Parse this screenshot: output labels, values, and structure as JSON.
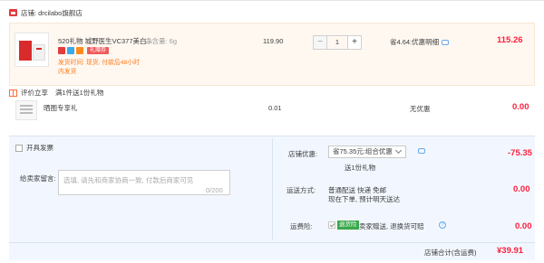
{
  "store": {
    "label": "店铺:",
    "name": "drcilabo旗舰店"
  },
  "item": {
    "title": "520礼物 城野医生VC377美白...",
    "spec": "净含量: 6g",
    "gift_badge": "礼赠券",
    "ship_line1": "发货时间: 现货, 付款后48小时",
    "ship_line2": "内发货",
    "price": "119.90",
    "quantity": "1",
    "discount": "省4.64:优惠明细",
    "subtotal": "115.26"
  },
  "review_gift": {
    "tag": "评价立享",
    "desc": "满1件送1份礼物",
    "gift_name": "晒图专享礼",
    "gift_price": "0.01",
    "gift_discount": "无优惠",
    "gift_subtotal": "0.00"
  },
  "options": {
    "invoice_label": "开具发票",
    "message_label": "给卖家留言:",
    "message_placeholder": "选填, 请先和商家协商一致, 付款后商家可见",
    "message_count": "0/200",
    "shop_discount_label": "店铺优惠:",
    "shop_discount_select": "省75.35元:组合优惠",
    "shop_discount_sub": "送1份礼物",
    "shop_discount_amount": "-75.35",
    "shipping_label": "运送方式:",
    "shipping_method": "普通配送 快递 免邮",
    "shipping_note": "现在下单, 预计明天送达",
    "shipping_amount": "0.00",
    "insurance_label": "运费险:",
    "insurance_badge": "退货险",
    "insurance_text": "卖家赠送, 退换货可赔",
    "insurance_amount": "0.00"
  },
  "total": {
    "label": "店铺合计(含运费)",
    "amount": "¥39.91"
  },
  "colors": {
    "accent_red": "#ff1e3c",
    "highlight_bg": "#fff8f1",
    "panel_bg": "#f2f7ff"
  }
}
